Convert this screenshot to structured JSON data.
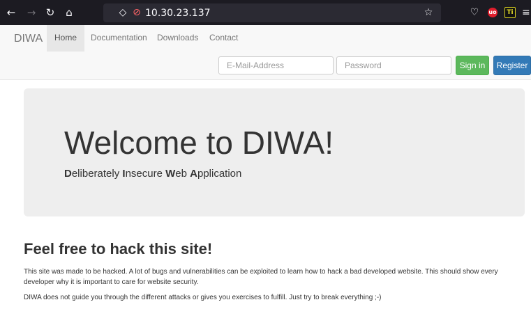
{
  "browser": {
    "address": "10.30.23.137",
    "icons": {
      "back": "back-arrow-icon",
      "forward": "forward-arrow-icon",
      "reload": "reload-icon",
      "home": "home-icon",
      "shield": "tracking-protection-shield-icon",
      "lock": "insecure-lock-icon",
      "bookmark": "bookmark-star-icon",
      "pocket": "pocket-icon",
      "ublock": "ublock-origin-icon",
      "extension": "extension-icon",
      "menu": "hamburger-menu-icon"
    },
    "ext_labels": {
      "ublock": "uo",
      "extension": "Ti"
    }
  },
  "navbar": {
    "brand": "DIWA",
    "items": [
      {
        "label": "Home",
        "active": true
      },
      {
        "label": "Documentation",
        "active": false
      },
      {
        "label": "Downloads",
        "active": false
      },
      {
        "label": "Contact",
        "active": false
      }
    ],
    "email_placeholder": "E-Mail-Address",
    "password_placeholder": "Password",
    "signin_label": "Sign in",
    "register_label": "Register"
  },
  "hero": {
    "title": "Welcome to DIWA!",
    "subtitle_parts": [
      {
        "initial": "D",
        "rest": "eliberately "
      },
      {
        "initial": "I",
        "rest": "nsecure "
      },
      {
        "initial": "W",
        "rest": "eb "
      },
      {
        "initial": "A",
        "rest": "pplication"
      }
    ]
  },
  "content": {
    "heading": "Feel free to hack this site!",
    "paragraph1": "This site was made to be hacked. A lot of bugs and vulnerabilities can be exploited to learn how to hack a bad developed website. This should show every developer why it is important to care for website security.",
    "paragraph2": "DIWA does not guide you through the different attacks or gives you exercises to fulfill. Just try to break everything ;-)"
  },
  "colors": {
    "browser_chrome": "#1c1b22",
    "url_bar": "#2b2a33",
    "navbar_bg": "#f8f8f8",
    "jumbotron_bg": "#eeeeee",
    "signin_green": "#5cb85c",
    "register_blue": "#337ab7"
  }
}
